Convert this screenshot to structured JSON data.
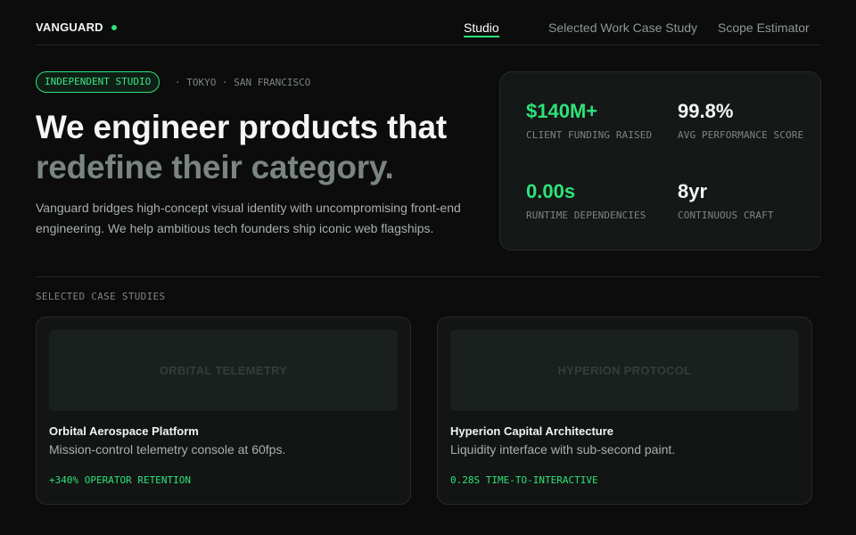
{
  "brand": {
    "name": "VANGUARD",
    "accent": "#2ee27a"
  },
  "nav": {
    "links": [
      {
        "label": "Studio",
        "active": true
      },
      {
        "label": "Selected Work Case Study",
        "active": false
      },
      {
        "label": "Scope Estimator",
        "active": false
      }
    ]
  },
  "hero": {
    "badge": "INDEPENDENT STUDIO",
    "locations": "· TOKYO · SAN FRANCISCO",
    "headline_line1": "We engineer products that",
    "headline_line2": "redefine their category.",
    "lead": "Vanguard bridges high-concept visual identity with uncompromising front-end engineering. We help ambitious tech founders ship iconic web flagships."
  },
  "stats": [
    {
      "value": "$140M+",
      "label": "CLIENT FUNDING RAISED",
      "accent": true
    },
    {
      "value": "99.8%",
      "label": "AVG PERFORMANCE SCORE",
      "accent": false
    },
    {
      "value": "0.00s",
      "label": "RUNTIME DEPENDENCIES",
      "accent": true
    },
    {
      "value": "8yr",
      "label": "CONTINUOUS CRAFT",
      "accent": false
    }
  ],
  "case_studies": {
    "section_label": "SELECTED CASE STUDIES",
    "items": [
      {
        "thumb_label": "ORBITAL TELEMETRY",
        "title": "Orbital Aerospace Platform",
        "description": "Mission-control telemetry console at 60fps.",
        "metric": "+340% OPERATOR RETENTION"
      },
      {
        "thumb_label": "HYPERION PROTOCOL",
        "title": "Hyperion Capital Architecture",
        "description": "Liquidity interface with sub-second paint.",
        "metric": "0.28S TIME-TO-INTERACTIVE"
      }
    ]
  }
}
